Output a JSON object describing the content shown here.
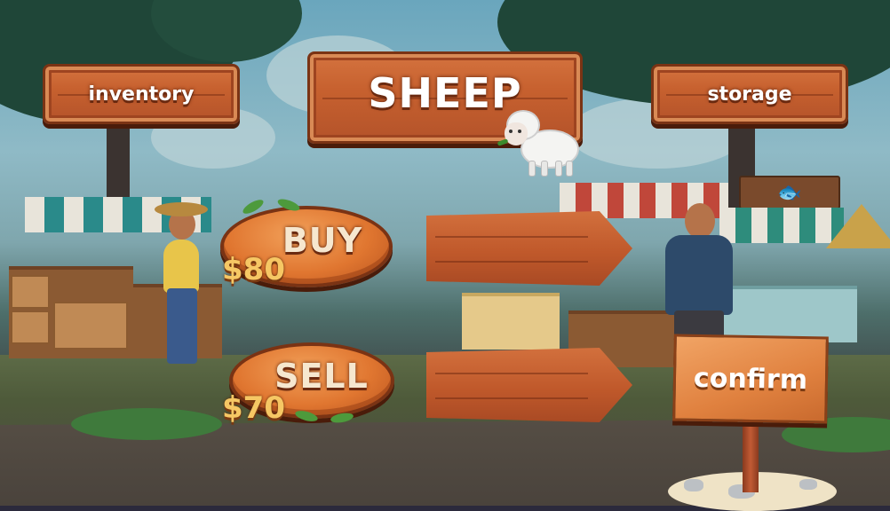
{
  "header": {
    "inventory_label": "inventory",
    "animal_name": "SHEEP",
    "storage_label": "storage"
  },
  "trade": {
    "buy_label": "BUY",
    "buy_price": "$80",
    "sell_label": "SELL",
    "sell_price": "$70",
    "buy_quantity": "",
    "sell_quantity": ""
  },
  "actions": {
    "confirm_label": "confirm"
  },
  "icons": {
    "animal": "sheep-icon",
    "market_sign": "fish-icon"
  },
  "colors": {
    "wood": "#c7612f",
    "wood_dark": "#7a3314",
    "price_gold": "#f6c764",
    "button_orange": "#e07630"
  }
}
